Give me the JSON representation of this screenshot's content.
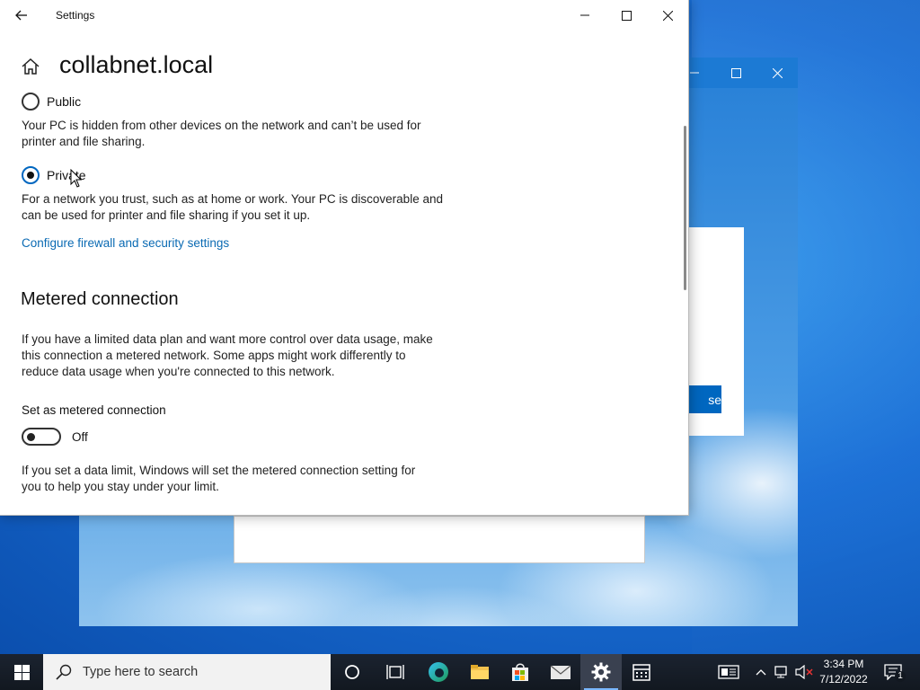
{
  "window": {
    "title": "Settings"
  },
  "page": {
    "title": "collabnet.local"
  },
  "network_profile": {
    "public": {
      "label": "Public",
      "selected": false,
      "description": "Your PC is hidden from other devices on the network and can’t be used for printer and file sharing."
    },
    "private": {
      "label": "Private",
      "selected": true,
      "description": "For a network you trust, such as at home or work. Your PC is discoverable and can be used for printer and file sharing if you set it up."
    },
    "firewall_link": "Configure firewall and security settings"
  },
  "metered": {
    "heading": "Metered connection",
    "description": "If you have a limited data plan and want more control over data usage, make this connection a metered network. Some apps might work differently to reduce data usage when you're connected to this network.",
    "toggle_label": "Set as metered connection",
    "toggle_state": "Off",
    "limit_note": "If you set a data limit, Windows will set the metered connection setting for you to help you stay under your limit."
  },
  "background_dialog": {
    "button_fragment": "se"
  },
  "taskbar": {
    "search_placeholder": "Type here to search",
    "time": "3:34 PM",
    "date": "7/12/2022",
    "notification_count": "1",
    "pinned": [
      "cortana-icon",
      "task-view-icon",
      "edge-icon",
      "file-explorer-icon",
      "store-icon",
      "mail-icon",
      "settings-icon",
      "calendar-icon"
    ]
  },
  "colors": {
    "accent": "#0067c0",
    "link": "#0a6ab3",
    "taskbar": "#121820"
  }
}
